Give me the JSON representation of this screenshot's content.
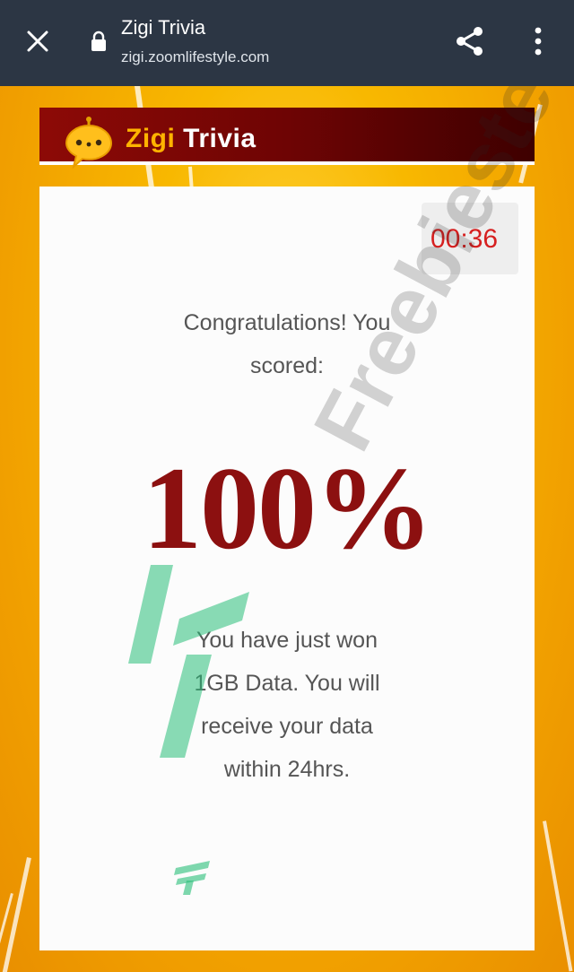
{
  "browser": {
    "title": "Zigi Trivia",
    "url": "zigi.zoomlifestyle.com",
    "icons": {
      "close": "close-icon",
      "lock": "lock-icon",
      "share": "share-icon",
      "menu": "more-vert-icon"
    }
  },
  "banner": {
    "brand_first": "Zigi",
    "brand_second": "Trivia"
  },
  "quiz": {
    "timer": "00:36",
    "congrats_line1": "Congratulations! You",
    "congrats_line2": "scored:",
    "score": "100%",
    "message_lines": [
      "You have just won",
      "1GB Data. You will",
      "receive your data",
      "within 24hrs."
    ]
  },
  "watermark": {
    "text": "Freebiestech"
  },
  "colors": {
    "topbar": "#2c3644",
    "banner": "#7a0606",
    "brand_accent": "#ffb300",
    "timer": "#d62020",
    "score": "#8c1010",
    "background": "#f5a300"
  }
}
